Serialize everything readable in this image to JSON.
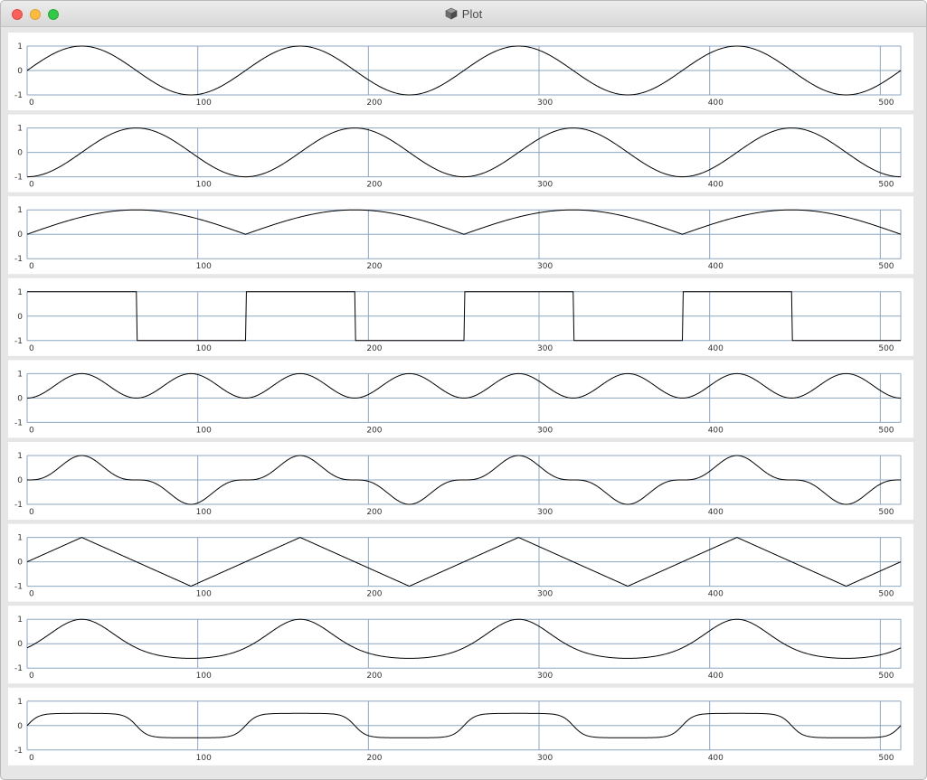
{
  "window": {
    "title": "Plot",
    "icon": "app-cube-icon"
  },
  "colors": {
    "grid": "#8da6c0",
    "line": "#000000",
    "panel_bg": "#ffffff",
    "window_bg": "#e6e6e6"
  },
  "chart_data": [
    {
      "type": "line",
      "waveform": "sine",
      "xlim": [
        0,
        512
      ],
      "ylim": [
        -1,
        1
      ],
      "grid": true,
      "period": 128,
      "phase": 0,
      "amplitude": 1,
      "offset": 0,
      "xticks": [
        "0",
        "100",
        "200",
        "300",
        "400",
        "500"
      ],
      "yticks": [
        "1",
        "0",
        "-1"
      ]
    },
    {
      "type": "line",
      "waveform": "negative-cosine",
      "xlim": [
        0,
        512
      ],
      "ylim": [
        -1,
        1
      ],
      "grid": true,
      "period": 128,
      "phase": 0,
      "amplitude": 1,
      "offset": 0,
      "xticks": [
        "0",
        "100",
        "200",
        "300",
        "400",
        "500"
      ],
      "yticks": [
        "1",
        "0",
        "-1"
      ]
    },
    {
      "type": "line",
      "waveform": "absolute-sine",
      "xlim": [
        0,
        512
      ],
      "ylim": [
        -1,
        1
      ],
      "grid": true,
      "period": 128,
      "phase": 0,
      "amplitude": 1,
      "offset": 0,
      "xticks": [
        "0",
        "100",
        "200",
        "300",
        "400",
        "500"
      ],
      "yticks": [
        "1",
        "0",
        "-1"
      ]
    },
    {
      "type": "line",
      "waveform": "square",
      "xlim": [
        0,
        512
      ],
      "ylim": [
        -1,
        1
      ],
      "grid": true,
      "period": 128,
      "phase": 0,
      "amplitude": 1,
      "offset": 0,
      "xticks": [
        "0",
        "100",
        "200",
        "300",
        "400",
        "500"
      ],
      "yticks": [
        "1",
        "0",
        "-1"
      ]
    },
    {
      "type": "line",
      "waveform": "sine-squared",
      "xlim": [
        0,
        512
      ],
      "ylim": [
        -1,
        1
      ],
      "grid": true,
      "period": 128,
      "phase": 0,
      "amplitude": 1,
      "offset": 0,
      "xticks": [
        "0",
        "100",
        "200",
        "300",
        "400",
        "500"
      ],
      "yticks": [
        "1",
        "0",
        "-1"
      ]
    },
    {
      "type": "line",
      "waveform": "sine-cubed",
      "xlim": [
        0,
        512
      ],
      "ylim": [
        -1,
        1
      ],
      "grid": true,
      "period": 128,
      "phase": 0,
      "amplitude": 1,
      "offset": 0,
      "xticks": [
        "0",
        "100",
        "200",
        "300",
        "400",
        "500"
      ],
      "yticks": [
        "1",
        "0",
        "-1"
      ]
    },
    {
      "type": "line",
      "waveform": "triangle",
      "xlim": [
        0,
        512
      ],
      "ylim": [
        -1,
        1
      ],
      "grid": true,
      "period": 128,
      "phase": 0,
      "amplitude": 1,
      "offset": 0,
      "xticks": [
        "0",
        "100",
        "200",
        "300",
        "400",
        "500"
      ],
      "yticks": [
        "1",
        "0",
        "-1"
      ]
    },
    {
      "type": "line",
      "waveform": "exp-sine",
      "xlim": [
        0,
        512
      ],
      "ylim": [
        -1,
        1
      ],
      "grid": true,
      "period": 128,
      "phase": 0,
      "amplitude": 1,
      "offset": 0,
      "xticks": [
        "0",
        "100",
        "200",
        "300",
        "400",
        "500"
      ],
      "yticks": [
        "1",
        "0",
        "-1"
      ]
    },
    {
      "type": "line",
      "waveform": "soft-square",
      "xlim": [
        0,
        512
      ],
      "ylim": [
        -1,
        1
      ],
      "grid": true,
      "period": 128,
      "phase": 0,
      "amplitude": 0.5,
      "offset": 0,
      "xticks": [
        "0",
        "100",
        "200",
        "300",
        "400",
        "500"
      ],
      "yticks": [
        "1",
        "0",
        "-1"
      ]
    }
  ]
}
